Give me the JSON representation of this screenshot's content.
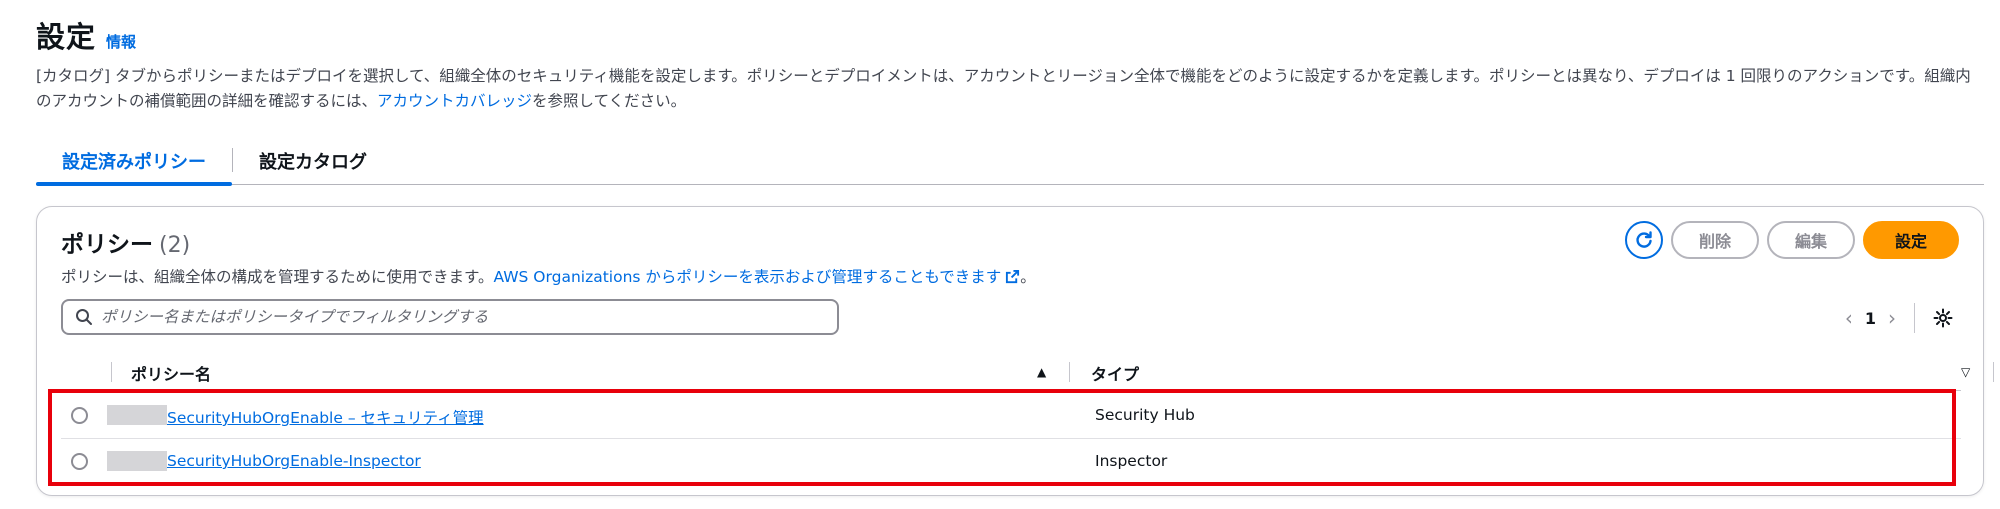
{
  "header": {
    "title": "設定",
    "info_link": "情報",
    "description_part1": "[カタログ] タブからポリシーまたはデプロイを選択して、組織全体のセキュリティ機能を設定します。ポリシーとデプロイメントは、アカウントとリージョン全体で機能をどのように設定するかを定義します。ポリシーとは異なり、デプロイは 1 回限りのアクションです。組織内のアカウントの補償範囲の詳細を確認するには、",
    "description_link": "アカウントカバレッジ",
    "description_part2": "を参照してください。"
  },
  "tabs": [
    {
      "label": "設定済みポリシー",
      "active": true
    },
    {
      "label": "設定カタログ",
      "active": false
    }
  ],
  "panel": {
    "title": "ポリシー",
    "count": "(2)",
    "description_text": "ポリシーは、組織全体の構成を管理するために使用できます。",
    "description_link": "AWS Organizations からポリシーを表示および管理することもできます",
    "description_end": "。",
    "actions": {
      "refresh_icon": "refresh-icon",
      "delete_label": "削除",
      "edit_label": "編集",
      "create_label": "設定"
    },
    "search": {
      "placeholder": "ポリシー名またはポリシータイプでフィルタリングする",
      "value": ""
    },
    "pagination": {
      "current_page": "1"
    },
    "columns": [
      "ポリシー名",
      "タイプ"
    ],
    "rows": [
      {
        "name": "SecurityHubOrgEnable – セキュリティ管理",
        "type": "Security Hub"
      },
      {
        "name": "SecurityHubOrgEnable-Inspector",
        "type": "Inspector"
      }
    ]
  },
  "colors": {
    "link": "#006ce0",
    "primary_button": "#ff9900",
    "highlight_box": "#e8000b"
  }
}
